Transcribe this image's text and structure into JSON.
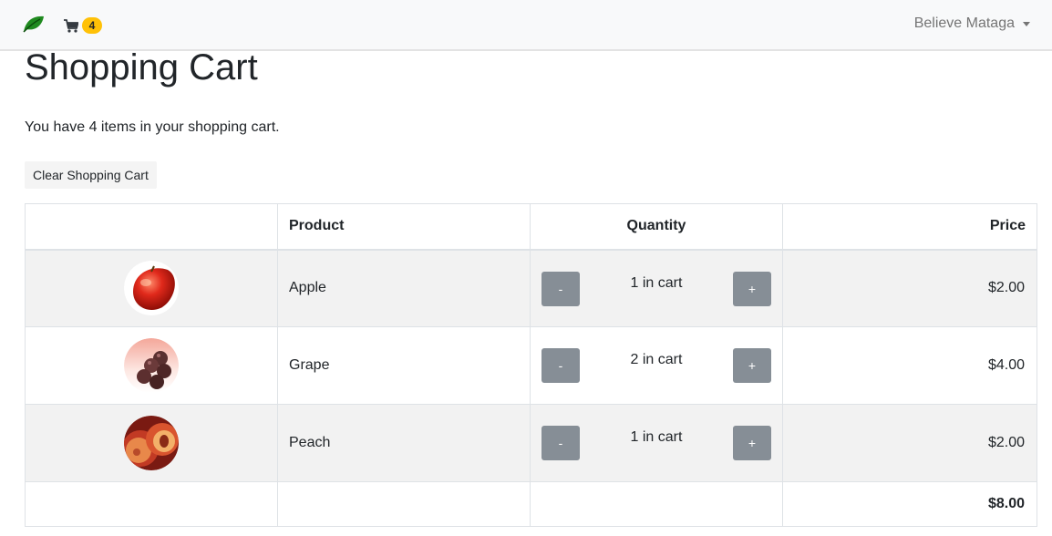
{
  "nav": {
    "cart_count": "4",
    "user_name": "Believe Mataga"
  },
  "page": {
    "title": "Shopping Cart",
    "summary": "You have 4 items in your shopping cart.",
    "clear_label": "Clear Shopping Cart"
  },
  "table": {
    "headers": {
      "image": "",
      "product": "Product",
      "quantity": "Quantity",
      "price": "Price"
    },
    "rows": [
      {
        "product": "Apple",
        "quantity": "1 in cart",
        "price": "$2.00",
        "image": "apple-image",
        "minus": "-",
        "plus": "+"
      },
      {
        "product": "Grape",
        "quantity": "2 in cart",
        "price": "$4.00",
        "image": "grape-image",
        "minus": "-",
        "plus": "+"
      },
      {
        "product": "Peach",
        "quantity": "1 in cart",
        "price": "$2.00",
        "image": "peach-image",
        "minus": "-",
        "plus": "+"
      }
    ],
    "total": "$8.00"
  },
  "colors": {
    "navbar_bg": "#f8f9fa",
    "badge": "#ffc107",
    "qty_button": "#868e96",
    "row_stripe": "#f2f2f2",
    "brand_leaf": "#1f8a1f"
  }
}
